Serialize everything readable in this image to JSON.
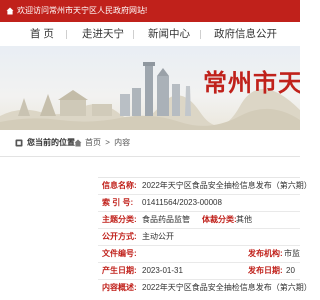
{
  "topbar": {
    "welcome": "欢迎访问常州市天宁区人民政府网站!"
  },
  "nav": {
    "items": [
      "首 页",
      "走进天宁",
      "新闻中心",
      "政府信息公开"
    ]
  },
  "banner": {
    "title": "常州市天宁"
  },
  "breadcrumb": {
    "label": "您当前的位置",
    "home": "首页",
    "sep": ">",
    "current": "内容"
  },
  "info": {
    "index_name_label": "信息名称:",
    "index_name": "2022年天宁区食品安全抽检信息发布（第六期）",
    "index_no_label": "索 引 号:",
    "index_no": "01411564/2023-00008",
    "category_label": "主题分类:",
    "category": "食品药品监管",
    "body_label": "体裁分类:",
    "body": "其他",
    "public_label": "公开方式:",
    "public": "主动公开",
    "doc_no_label": "文件编号:",
    "doc_no": "",
    "date_label": "产生日期:",
    "date": "2023-01-31",
    "content_label": "内容概述:",
    "content": "2022年天宁区食品安全抽检信息发布（第六期）",
    "issuer_label": "发布机构:",
    "issuer": "市监",
    "pubdate_label": "发布日期:",
    "pubdate": "20"
  },
  "colors": {
    "brand_red": "#c0211b"
  }
}
